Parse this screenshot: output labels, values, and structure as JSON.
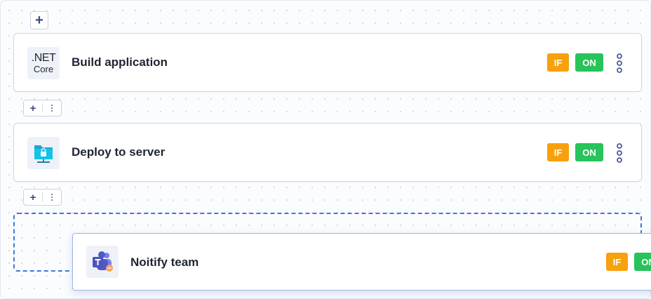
{
  "toolbar": {
    "add_symbol": "+"
  },
  "steps": [
    {
      "title": "Build application",
      "icon": "dotnet-core-icon",
      "icon_text_top": ".NET",
      "icon_text_bottom": "Core",
      "badge_if": "IF",
      "badge_on": "ON"
    },
    {
      "title": "Deploy to server",
      "icon": "server-upload-icon",
      "badge_if": "IF",
      "badge_on": "ON"
    }
  ],
  "connector": {
    "add_symbol": "+"
  },
  "dragging_step": {
    "title": "Noitify team",
    "icon": "microsoft-teams-icon",
    "badge_if": "IF",
    "badge_on": "ON"
  },
  "colors": {
    "badge_if": "#f6a10d",
    "badge_on": "#28c35a",
    "accent_dashed": "#3f78d9",
    "text": "#1f2533"
  }
}
